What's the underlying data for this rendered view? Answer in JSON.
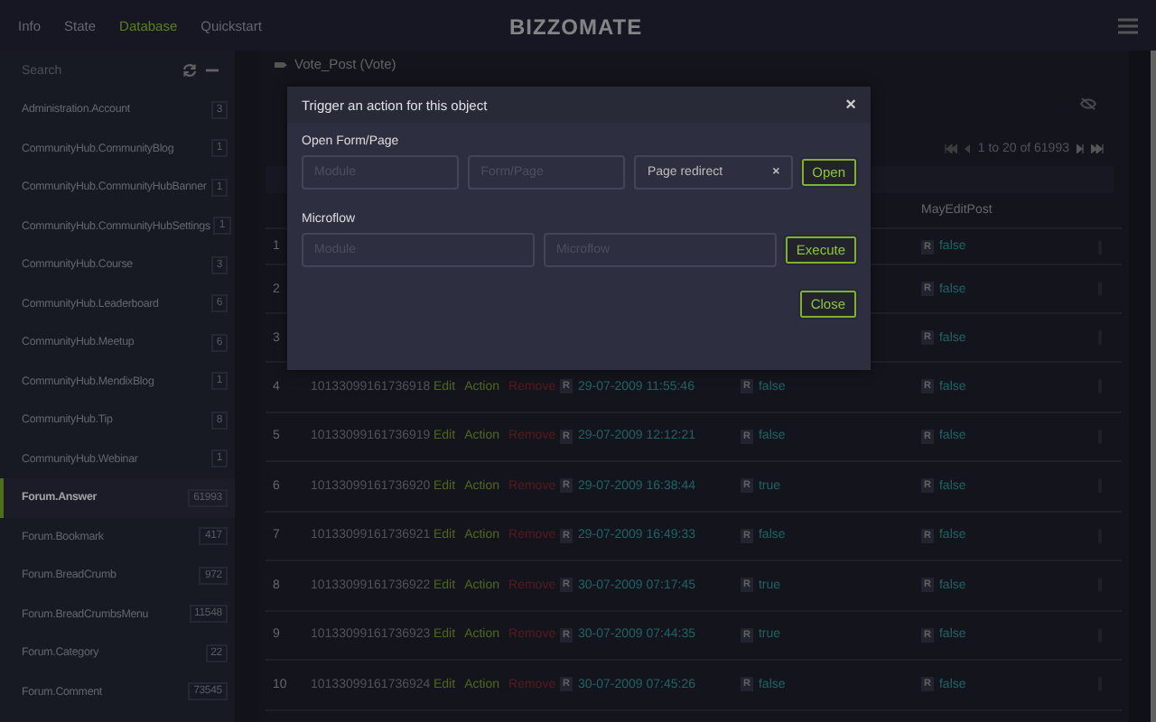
{
  "nav": {
    "items": [
      {
        "label": "Info",
        "selected": false
      },
      {
        "label": "State",
        "selected": false
      },
      {
        "label": "Database",
        "selected": true
      },
      {
        "label": "Quickstart",
        "selected": false
      }
    ],
    "logo": "BIZZOMATE"
  },
  "sidebar": {
    "search": {
      "placeholder": "Search"
    },
    "items": [
      {
        "name": "Administration.Account",
        "count": "3",
        "selected": false
      },
      {
        "name": "CommunityHub.CommunityBlog",
        "count": "1",
        "selected": false
      },
      {
        "name": "CommunityHub.CommunityHubBanner",
        "count": "1",
        "selected": false
      },
      {
        "name": "CommunityHub.CommunityHubSettings",
        "count": "1",
        "selected": false
      },
      {
        "name": "CommunityHub.Course",
        "count": "3",
        "selected": false
      },
      {
        "name": "CommunityHub.Leaderboard",
        "count": "6",
        "selected": false
      },
      {
        "name": "CommunityHub.Meetup",
        "count": "6",
        "selected": false
      },
      {
        "name": "CommunityHub.MendixBlog",
        "count": "1",
        "selected": false
      },
      {
        "name": "CommunityHub.Tip",
        "count": "8",
        "selected": false
      },
      {
        "name": "CommunityHub.Webinar",
        "count": "1",
        "selected": false
      },
      {
        "name": "Forum.Answer",
        "count": "61993",
        "selected": true
      },
      {
        "name": "Forum.Bookmark",
        "count": "417",
        "selected": false
      },
      {
        "name": "Forum.BreadCrumb",
        "count": "972",
        "selected": false
      },
      {
        "name": "Forum.BreadCrumbsMenu",
        "count": "11548",
        "selected": false
      },
      {
        "name": "Forum.Category",
        "count": "22",
        "selected": false
      },
      {
        "name": "Forum.Comment",
        "count": "73545",
        "selected": false
      }
    ]
  },
  "main": {
    "breadcrumb": "Vote_Post (Vote)",
    "pager": "1 to 20 of 61993",
    "table": {
      "header": {
        "may_edit_post": "MayEditPost"
      },
      "rows": [
        {
          "index": "1",
          "may_edit_post": {
            "badge": "R",
            "value": "false"
          }
        },
        {
          "index": "2",
          "may_edit_post": {
            "badge": "R",
            "value": "false"
          }
        },
        {
          "index": "3",
          "may_edit_post": {
            "badge": "R",
            "value": "false"
          }
        },
        {
          "index": "4",
          "id": "10133099161736918",
          "actions": [
            {
              "label": "Edit",
              "kind": "link"
            },
            {
              "label": "Action",
              "kind": "link"
            },
            {
              "label": "Remove",
              "kind": "danger"
            }
          ],
          "date": {
            "badge": "R",
            "value": "29-07-2009 11:55:46"
          },
          "flag": {
            "badge": "R",
            "value": "false"
          },
          "may_edit_post": {
            "badge": "R",
            "value": "false"
          }
        },
        {
          "index": "5",
          "id": "10133099161736919",
          "actions": [
            {
              "label": "Edit",
              "kind": "link"
            },
            {
              "label": "Action",
              "kind": "link"
            },
            {
              "label": "Remove",
              "kind": "danger"
            }
          ],
          "date": {
            "badge": "R",
            "value": "29-07-2009 12:12:21"
          },
          "flag": {
            "badge": "R",
            "value": "false"
          },
          "may_edit_post": {
            "badge": "R",
            "value": "false"
          }
        },
        {
          "index": "6",
          "id": "10133099161736920",
          "actions": [
            {
              "label": "Edit",
              "kind": "link"
            },
            {
              "label": "Action",
              "kind": "link"
            },
            {
              "label": "Remove",
              "kind": "danger"
            }
          ],
          "date": {
            "badge": "R",
            "value": "29-07-2009 16:38:44"
          },
          "flag": {
            "badge": "R",
            "value": "true"
          },
          "may_edit_post": {
            "badge": "R",
            "value": "false"
          }
        },
        {
          "index": "7",
          "id": "10133099161736921",
          "actions": [
            {
              "label": "Edit",
              "kind": "link"
            },
            {
              "label": "Action",
              "kind": "link"
            },
            {
              "label": "Remove",
              "kind": "danger"
            }
          ],
          "date": {
            "badge": "R",
            "value": "29-07-2009 16:49:33"
          },
          "flag": {
            "badge": "R",
            "value": "false"
          },
          "may_edit_post": {
            "badge": "R",
            "value": "false"
          }
        },
        {
          "index": "8",
          "id": "10133099161736922",
          "actions": [
            {
              "label": "Edit",
              "kind": "link"
            },
            {
              "label": "Action",
              "kind": "link"
            },
            {
              "label": "Remove",
              "kind": "danger"
            }
          ],
          "date": {
            "badge": "R",
            "value": "30-07-2009 07:17:45"
          },
          "flag": {
            "badge": "R",
            "value": "true"
          },
          "may_edit_post": {
            "badge": "R",
            "value": "false"
          }
        },
        {
          "index": "9",
          "id": "10133099161736923",
          "actions": [
            {
              "label": "Edit",
              "kind": "link"
            },
            {
              "label": "Action",
              "kind": "link"
            },
            {
              "label": "Remove",
              "kind": "danger"
            }
          ],
          "date": {
            "badge": "R",
            "value": "30-07-2009 07:44:35"
          },
          "flag": {
            "badge": "R",
            "value": "true"
          },
          "may_edit_post": {
            "badge": "R",
            "value": "false"
          }
        },
        {
          "index": "10",
          "id": "10133099161736924",
          "actions": [
            {
              "label": "Edit",
              "kind": "link"
            },
            {
              "label": "Action",
              "kind": "link"
            },
            {
              "label": "Remove",
              "kind": "danger"
            }
          ],
          "date": {
            "badge": "R",
            "value": "30-07-2009 07:45:26"
          },
          "flag": {
            "badge": "R",
            "value": "false"
          },
          "may_edit_post": {
            "badge": "R",
            "value": "false"
          }
        }
      ]
    }
  },
  "modal": {
    "title": "Trigger an action for this object",
    "close_icon": "×",
    "sections": [
      {
        "label": "Open Form/Page",
        "fields": [
          {
            "kind": "input",
            "placeholder": "Module"
          },
          {
            "kind": "input",
            "placeholder": "Form/Page"
          },
          {
            "kind": "select",
            "value": "Page redirect",
            "clear": "×"
          }
        ],
        "button": "Open"
      },
      {
        "label": "Microflow",
        "fields": [
          {
            "kind": "input",
            "placeholder": "Module"
          },
          {
            "kind": "input",
            "placeholder": "Microflow"
          }
        ],
        "button": "Execute"
      }
    ],
    "footer_button": "Close"
  }
}
